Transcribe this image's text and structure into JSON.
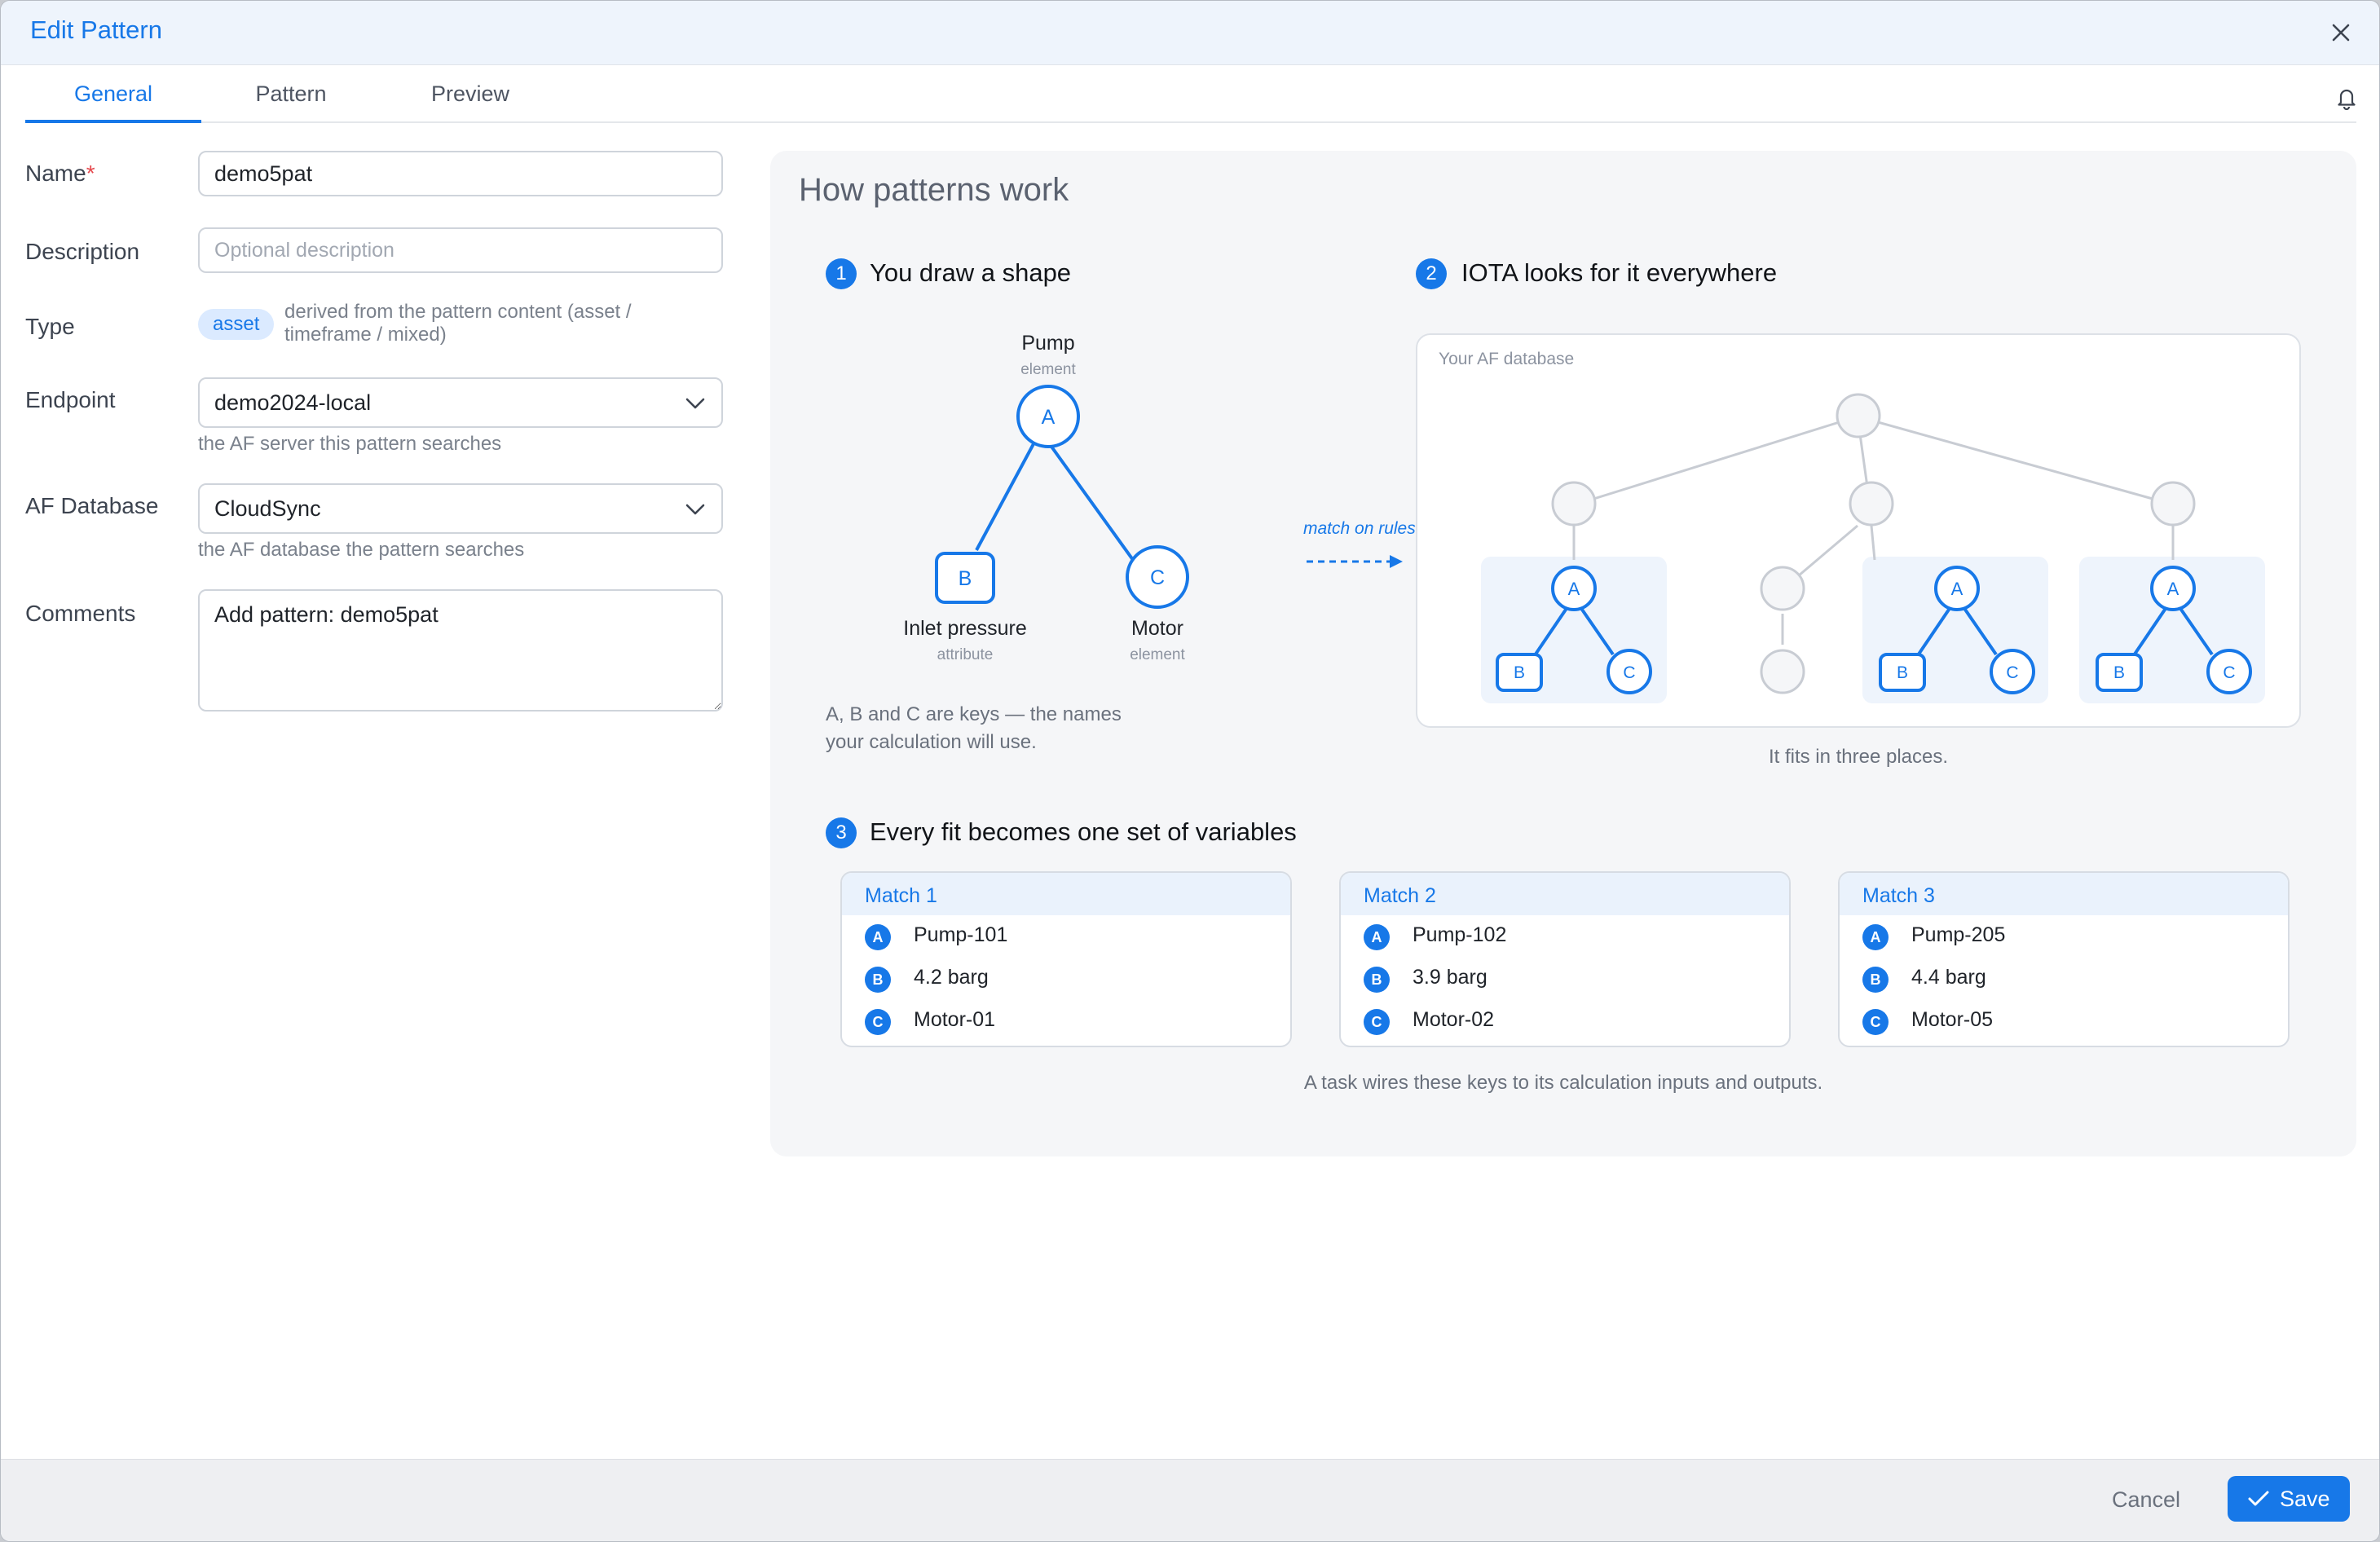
{
  "dialog": {
    "title": "Edit Pattern"
  },
  "tabs": [
    {
      "label": "General",
      "active": true
    },
    {
      "label": "Pattern",
      "active": false
    },
    {
      "label": "Preview",
      "active": false
    }
  ],
  "icons": {
    "close": "close-icon",
    "bell": "bell-icon",
    "chevron": "chevron-down-icon",
    "check": "check-icon"
  },
  "form": {
    "name": {
      "label": "Name",
      "required_mark": "*",
      "value": "demo5pat"
    },
    "description": {
      "label": "Description",
      "placeholder": "Optional description",
      "value": ""
    },
    "type": {
      "label": "Type",
      "badge": "asset",
      "note": "derived from the pattern content (asset / timeframe / mixed)"
    },
    "endpoint": {
      "label": "Endpoint",
      "value": "demo2024-local",
      "hint": "the AF server this pattern searches"
    },
    "af_database": {
      "label": "AF Database",
      "value": "CloudSync",
      "hint": "the AF database the pattern searches"
    },
    "comments": {
      "label": "Comments",
      "value": "Add pattern: demo5pat"
    }
  },
  "help": {
    "title": "How patterns work",
    "step1": {
      "num": "1",
      "title": "You draw a shape",
      "nodes": {
        "a": {
          "key": "A",
          "label": "Pump",
          "sub": "element"
        },
        "b": {
          "key": "B",
          "label": "Inlet pressure",
          "sub": "attribute"
        },
        "c": {
          "key": "C",
          "label": "Motor",
          "sub": "element"
        }
      },
      "note_line1": "A, B and C are keys — the names",
      "note_line2": "your calculation will use."
    },
    "arrow_label": "match on rules",
    "step2": {
      "num": "2",
      "title": "IOTA looks for it everywhere",
      "db_label": "Your AF database",
      "caption": "It fits in three places."
    },
    "step3": {
      "num": "3",
      "title": "Every fit becomes one set of variables",
      "matches": [
        {
          "title": "Match 1",
          "rows": [
            {
              "key": "A",
              "value": "Pump-101"
            },
            {
              "key": "B",
              "value": "4.2 barg"
            },
            {
              "key": "C",
              "value": "Motor-01"
            }
          ]
        },
        {
          "title": "Match 2",
          "rows": [
            {
              "key": "A",
              "value": "Pump-102"
            },
            {
              "key": "B",
              "value": "3.9 barg"
            },
            {
              "key": "C",
              "value": "Motor-02"
            }
          ]
        },
        {
          "title": "Match 3",
          "rows": [
            {
              "key": "A",
              "value": "Pump-205"
            },
            {
              "key": "B",
              "value": "4.4 barg"
            },
            {
              "key": "C",
              "value": "Motor-05"
            }
          ]
        }
      ],
      "caption": "A task wires these keys to its calculation inputs and outputs."
    }
  },
  "footer": {
    "cancel": "Cancel",
    "save": "Save"
  },
  "colors": {
    "accent": "#1778e8",
    "required": "#e5484d",
    "muted_node": "#c8ccd3"
  }
}
